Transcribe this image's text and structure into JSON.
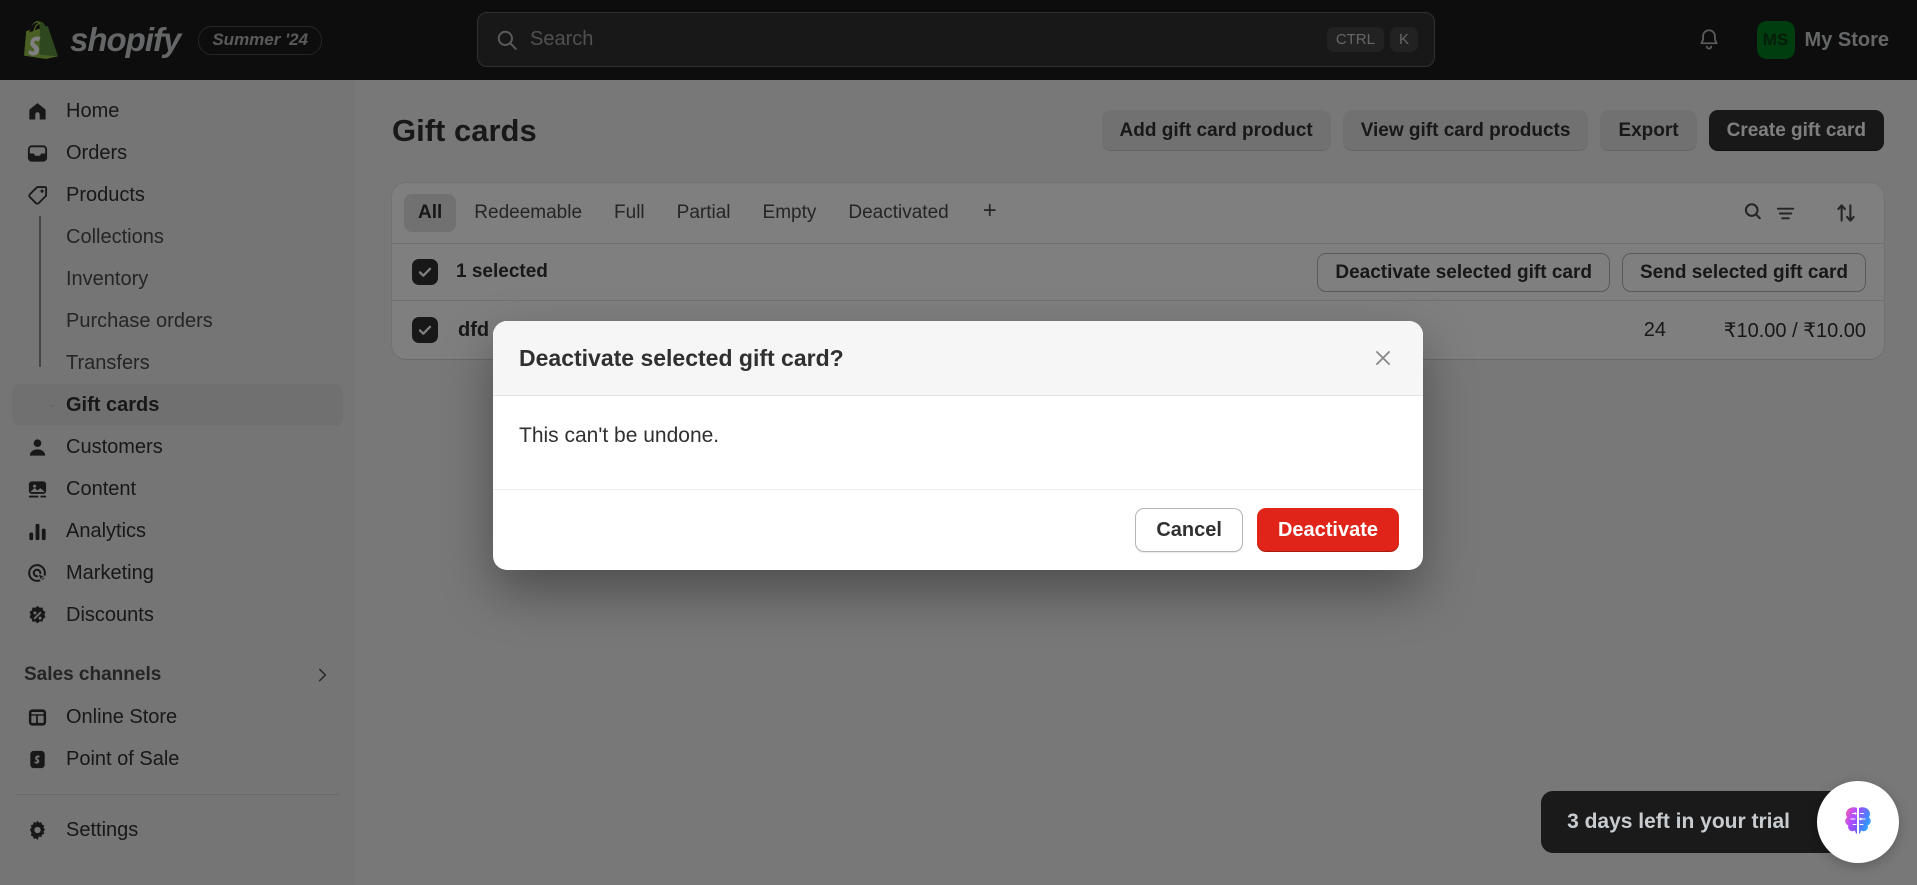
{
  "topbar": {
    "brand_name": "shopify",
    "season_badge": "Summer '24",
    "search": {
      "placeholder": "Search",
      "value": "",
      "kbd_ctrl": "CTRL",
      "kbd_key": "K"
    },
    "notifications_icon": "bell-icon",
    "store": {
      "initials": "MS",
      "name": "My Store"
    }
  },
  "sidebar": {
    "items": [
      {
        "label": "Home",
        "icon": "home-icon"
      },
      {
        "label": "Orders",
        "icon": "orders-inbox-icon"
      },
      {
        "label": "Products",
        "icon": "product-tag-icon"
      }
    ],
    "product_children": [
      {
        "label": "Collections"
      },
      {
        "label": "Inventory"
      },
      {
        "label": "Purchase orders"
      },
      {
        "label": "Transfers"
      },
      {
        "label": "Gift cards",
        "active": true
      }
    ],
    "items_after": [
      {
        "label": "Customers",
        "icon": "customer-person-icon"
      },
      {
        "label": "Content",
        "icon": "content-image-icon"
      },
      {
        "label": "Analytics",
        "icon": "analytics-bars-icon"
      },
      {
        "label": "Marketing",
        "icon": "marketing-target-icon"
      },
      {
        "label": "Discounts",
        "icon": "discount-badge-icon"
      }
    ],
    "section": {
      "label": "Sales channels",
      "chevron_icon": "chevron-right-icon"
    },
    "channels": [
      {
        "label": "Online Store",
        "icon": "storefront-icon"
      },
      {
        "label": "Point of Sale",
        "icon": "pos-icon"
      }
    ],
    "settings": {
      "label": "Settings",
      "icon": "gear-icon"
    }
  },
  "page": {
    "title": "Gift cards",
    "actions": [
      {
        "label": "Add gift card product",
        "style": "plain"
      },
      {
        "label": "View gift card products",
        "style": "plain"
      },
      {
        "label": "Export",
        "style": "plain"
      },
      {
        "label": "Create gift card",
        "style": "primary"
      }
    ]
  },
  "tabs": {
    "items": [
      {
        "label": "All",
        "active": true
      },
      {
        "label": "Redeemable",
        "active": false
      },
      {
        "label": "Full",
        "active": false
      },
      {
        "label": "Partial",
        "active": false
      },
      {
        "label": "Empty",
        "active": false
      },
      {
        "label": "Deactivated",
        "active": false
      }
    ],
    "add_label": "+",
    "tools": [
      {
        "icon": "search-filter-icon"
      },
      {
        "icon": "sort-arrows-icon"
      }
    ]
  },
  "selection": {
    "count_label": "1 selected",
    "checkbox_icon": "checkmark-icon",
    "actions": [
      {
        "label": "Deactivate selected gift card"
      },
      {
        "label": "Send selected gift card"
      }
    ]
  },
  "rows": [
    {
      "code": "dfd",
      "date": "24",
      "amount": "₹10.00 / ₹10.00",
      "selected": true
    }
  ],
  "modal": {
    "title": "Deactivate selected gift card?",
    "close_icon": "close-icon",
    "body_text": "This can't be undone.",
    "cancel_label": "Cancel",
    "confirm_label": "Deactivate",
    "confirm_color": "#e02419"
  },
  "toast": {
    "text": "3 days left in your trial",
    "assistant_icon": "brain-assistant-icon"
  }
}
